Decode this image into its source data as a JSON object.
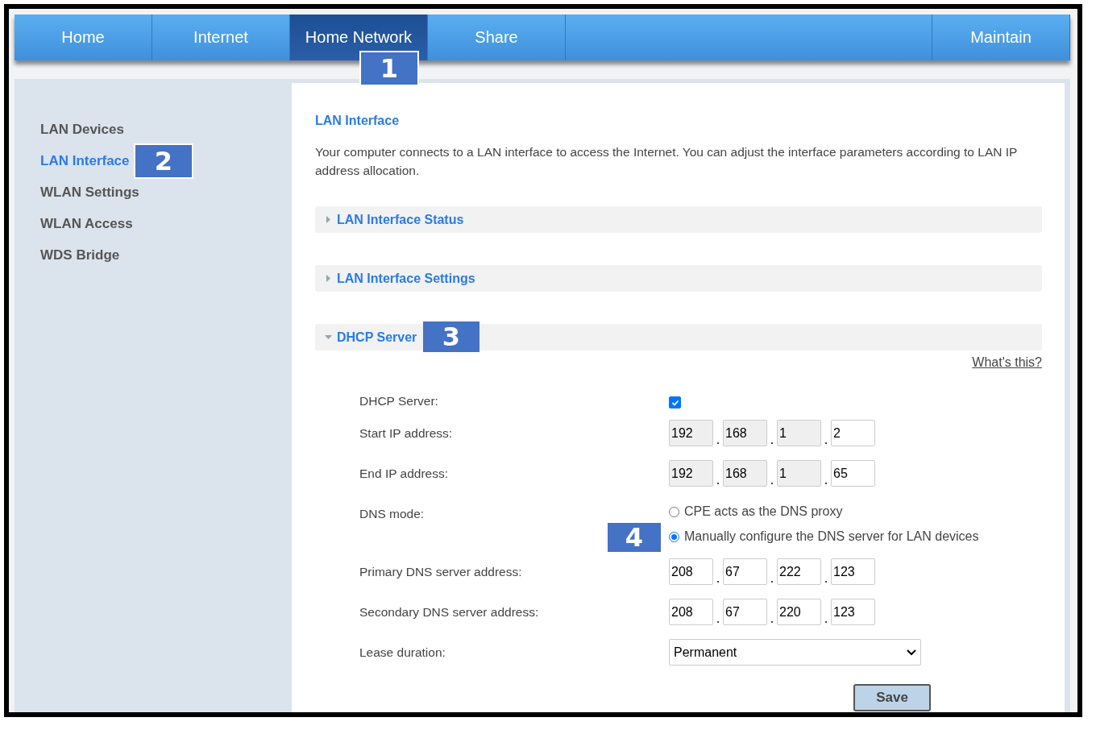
{
  "nav": {
    "tabs": [
      {
        "label": "Home",
        "selected": false
      },
      {
        "label": "Internet",
        "selected": false
      },
      {
        "label": "Home Network",
        "selected": true,
        "callout": "1"
      },
      {
        "label": "Share",
        "selected": false
      }
    ],
    "right_tab": {
      "label": "Maintain",
      "selected": false
    }
  },
  "sidebar": {
    "items": [
      {
        "label": "LAN Devices",
        "selected": false
      },
      {
        "label": "LAN Interface",
        "selected": true,
        "callout": "2"
      },
      {
        "label": "WLAN Settings",
        "selected": false
      },
      {
        "label": "WLAN Access",
        "selected": false
      },
      {
        "label": "WDS Bridge",
        "selected": false
      }
    ]
  },
  "content": {
    "title": "LAN Interface",
    "description": "Your computer connects to a LAN interface to access the Internet. You can adjust the interface parameters according to LAN IP address allocation.",
    "sections": [
      {
        "title": "LAN Interface Status",
        "expanded": false
      },
      {
        "title": "LAN Interface Settings",
        "expanded": false
      },
      {
        "title": "DHCP Server",
        "expanded": true,
        "callout": "3"
      }
    ],
    "help_link": "What's this?",
    "rows": [
      {
        "kind": "checkbox",
        "label": "DHCP Server:",
        "checked": true
      },
      {
        "kind": "ip",
        "label": "Start IP address:",
        "octets": [
          {
            "value": "192",
            "disabled": true
          },
          {
            "value": "168",
            "disabled": true
          },
          {
            "value": "1",
            "disabled": true
          },
          {
            "value": "2",
            "disabled": false
          }
        ]
      },
      {
        "kind": "ip",
        "label": "End IP address:",
        "octets": [
          {
            "value": "192",
            "disabled": true
          },
          {
            "value": "168",
            "disabled": true
          },
          {
            "value": "1",
            "disabled": true
          },
          {
            "value": "65",
            "disabled": false
          }
        ]
      },
      {
        "kind": "radio",
        "label": "DNS mode:",
        "options": [
          {
            "label": "CPE acts as the DNS proxy",
            "selected": false
          },
          {
            "label": "Manually configure the DNS server for LAN devices",
            "selected": true,
            "callout": "4"
          }
        ]
      },
      {
        "kind": "ip",
        "label": "Primary DNS server address:",
        "octets": [
          {
            "value": "208",
            "disabled": false
          },
          {
            "value": "67",
            "disabled": false
          },
          {
            "value": "222",
            "disabled": false
          },
          {
            "value": "123",
            "disabled": false
          }
        ]
      },
      {
        "kind": "ip",
        "label": "Secondary DNS server address:",
        "octets": [
          {
            "value": "208",
            "disabled": false
          },
          {
            "value": "67",
            "disabled": false
          },
          {
            "value": "220",
            "disabled": false
          },
          {
            "value": "123",
            "disabled": false
          }
        ]
      },
      {
        "kind": "select",
        "label": "Lease duration:",
        "value": "Permanent"
      }
    ],
    "save_button": "Save"
  }
}
